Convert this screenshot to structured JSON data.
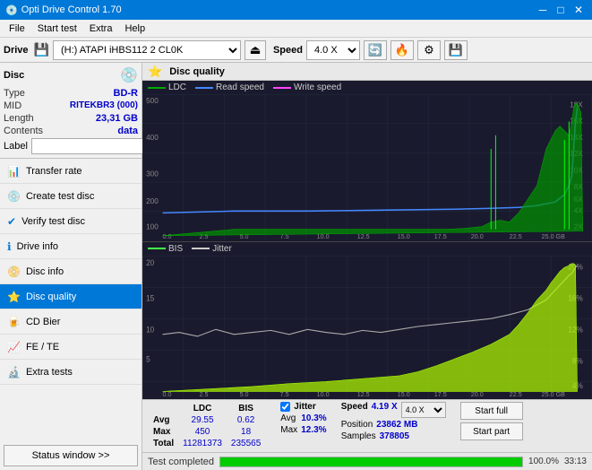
{
  "titlebar": {
    "title": "Opti Drive Control 1.70",
    "minimize": "─",
    "maximize": "□",
    "close": "✕"
  },
  "menu": {
    "items": [
      "File",
      "Start test",
      "Extra",
      "Help"
    ]
  },
  "drive_toolbar": {
    "drive_label": "Drive",
    "drive_value": "(H:) ATAPI iHBS112  2 CL0K",
    "speed_label": "Speed",
    "speed_value": "4.0 X"
  },
  "disc": {
    "title": "Disc",
    "type_label": "Type",
    "type_value": "BD-R",
    "mid_label": "MID",
    "mid_value": "RITEKBR3 (000)",
    "length_label": "Length",
    "length_value": "23,31 GB",
    "contents_label": "Contents",
    "contents_value": "data",
    "label_label": "Label"
  },
  "nav": {
    "items": [
      {
        "id": "transfer-rate",
        "label": "Transfer rate",
        "icon": "📊"
      },
      {
        "id": "create-test-disc",
        "label": "Create test disc",
        "icon": "💿"
      },
      {
        "id": "verify-test-disc",
        "label": "Verify test disc",
        "icon": "✅"
      },
      {
        "id": "drive-info",
        "label": "Drive info",
        "icon": "ℹ"
      },
      {
        "id": "disc-info",
        "label": "Disc info",
        "icon": "📀"
      },
      {
        "id": "disc-quality",
        "label": "Disc quality",
        "icon": "⭐",
        "active": true
      },
      {
        "id": "cd-bier",
        "label": "CD Bier",
        "icon": "🍺"
      },
      {
        "id": "fe-te",
        "label": "FE / TE",
        "icon": "📈"
      },
      {
        "id": "extra-tests",
        "label": "Extra tests",
        "icon": "🔬"
      }
    ],
    "status_btn": "Status window >>"
  },
  "chart": {
    "title": "Disc quality",
    "icon": "⭐",
    "legend_top": [
      {
        "label": "LDC",
        "color": "#00aa00"
      },
      {
        "label": "Read speed",
        "color": "#0088ff"
      },
      {
        "label": "Write speed",
        "color": "#ff00ff"
      }
    ],
    "legend_bottom": [
      {
        "label": "BIS",
        "color": "#44ff44"
      },
      {
        "label": "Jitter",
        "color": "#cccccc"
      }
    ],
    "top": {
      "y_left_max": 500,
      "y_right_labels": [
        "18X",
        "16X",
        "14X",
        "12X",
        "10X",
        "8X",
        "6X",
        "4X",
        "2X"
      ],
      "x_labels": [
        "0.0",
        "2.5",
        "5.0",
        "7.5",
        "10.0",
        "12.5",
        "15.0",
        "17.5",
        "20.0",
        "22.5",
        "25.0 GB"
      ]
    },
    "bottom": {
      "y_left_max": 20,
      "y_right_labels": [
        "20%",
        "16%",
        "12%",
        "8%",
        "4%"
      ],
      "x_labels": [
        "0.0",
        "2.5",
        "5.0",
        "7.5",
        "10.0",
        "12.5",
        "15.0",
        "17.5",
        "20.0",
        "22.5",
        "25.0 GB"
      ]
    }
  },
  "stats": {
    "columns": [
      "LDC",
      "BIS"
    ],
    "avg_label": "Avg",
    "avg_ldc": "29.55",
    "avg_bis": "0.62",
    "max_label": "Max",
    "max_ldc": "450",
    "max_bis": "18",
    "total_label": "Total",
    "total_ldc": "11281373",
    "total_bis": "235565",
    "jitter_label": "Jitter",
    "jitter_avg": "10.3%",
    "jitter_max": "12.3%",
    "speed_label": "Speed",
    "speed_value": "4.19 X",
    "speed_select": "4.0 X",
    "position_label": "Position",
    "position_value": "23862 MB",
    "samples_label": "Samples",
    "samples_value": "378805",
    "btn_start_full": "Start full",
    "btn_start_part": "Start part"
  },
  "progress": {
    "status": "Test completed",
    "percent": 100,
    "percent_text": "100.0%",
    "time": "33:13"
  }
}
